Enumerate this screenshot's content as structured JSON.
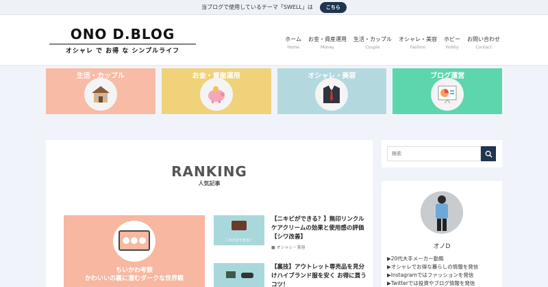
{
  "topbar": {
    "message": "当ブログで使用しているテーマ「SWELL」は",
    "button": "こちら"
  },
  "header": {
    "logo_title": "ONO D.BLOG",
    "logo_sub": "オシャレ で お得 な シンプルライフ",
    "nav": [
      {
        "jp": "ホーム",
        "en": "Home"
      },
      {
        "jp": "お金・資産運用",
        "en": "Money"
      },
      {
        "jp": "生活・カップル",
        "en": "Couple"
      },
      {
        "jp": "オシャレ・美容",
        "en": "Fashion"
      },
      {
        "jp": "ホビー",
        "en": "Hobby"
      },
      {
        "jp": "お問い合わせ",
        "en": "Contact"
      }
    ]
  },
  "categories": [
    {
      "label": "生活・カップル",
      "color": "#f8bba5",
      "icon": "house-icon"
    },
    {
      "label": "お金・資産運用",
      "color": "#f0d27a",
      "icon": "piggy-bank-icon"
    },
    {
      "label": "オシャレ・美容",
      "color": "#b3d9de",
      "icon": "suit-icon"
    },
    {
      "label": "ブログ運営",
      "color": "#5dd5ad",
      "icon": "chart-board-icon"
    }
  ],
  "ranking": {
    "title": "RANKING",
    "subtitle": "人気記事",
    "featured_title_1": "ちいかわ考察",
    "featured_title_2": "かわいいの裏に潜むダークな世界観",
    "posts": [
      {
        "title": "【ニキビができる？】無印リンクルケアクリームの効果と使用感の評価【シワ改善】",
        "category": "オシャレ・美容",
        "thumb_text": "ニキビができる？"
      },
      {
        "title": "【裏技】アウトレット専売品を見分けハイブランド服を安く お得に買うコツ！",
        "category": ""
      }
    ]
  },
  "search": {
    "placeholder": "検索"
  },
  "profile": {
    "name": "オノD",
    "items": [
      "▶20代大手メーカー勤務",
      "▶オシャレでお得な暮らしの情報を発信",
      "▶Instagramではファッションを発信",
      "▶Twitterでは投資やブログ情報を発信"
    ]
  }
}
